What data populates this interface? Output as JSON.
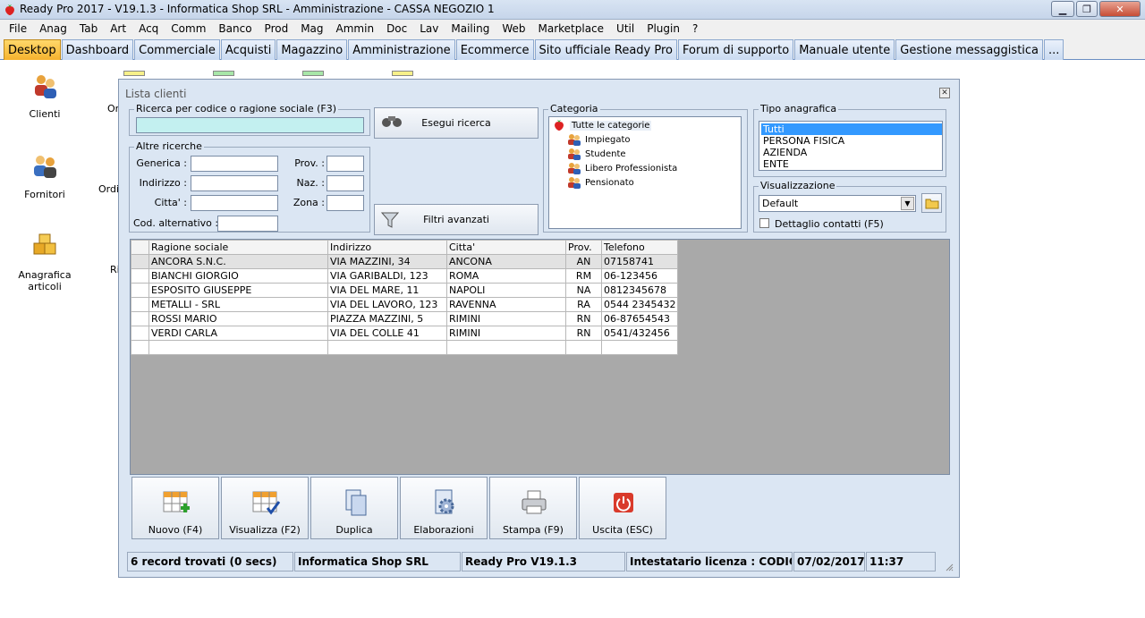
{
  "window": {
    "title": "Ready Pro 2017 - V19.1.3 - Informatica Shop SRL - Amministrazione - CASSA NEGOZIO 1"
  },
  "menu": [
    "File",
    "Anag",
    "Tab",
    "Art",
    "Acq",
    "Comm",
    "Banco",
    "Prod",
    "Mag",
    "Ammin",
    "Doc",
    "Lav",
    "Mailing",
    "Web",
    "Marketplace",
    "Util",
    "Plugin",
    "?"
  ],
  "tabs": [
    "Desktop",
    "Dashboard",
    "Commerciale",
    "Acquisti",
    "Magazzino",
    "Amministrazione",
    "Ecommerce",
    "Sito ufficiale Ready Pro",
    "Forum di supporto",
    "Manuale utente",
    "Gestione messaggistica",
    "..."
  ],
  "desktop": {
    "icons": [
      "Clienti",
      "Fornitori",
      "Anagrafica articoli"
    ],
    "partial_labels": [
      "Or",
      "Ordi",
      "Ri"
    ]
  },
  "dialog": {
    "title": "Lista clienti",
    "search": {
      "group_label": "Ricerca per codice o ragione sociale (F3)",
      "value": "",
      "button": "Esegui ricerca"
    },
    "other": {
      "group_label": "Altre ricerche",
      "generica": "Generica :",
      "indirizzo": "Indirizzo :",
      "citta": "Citta' :",
      "cod_alt": "Cod. alternativo :",
      "prov": "Prov. :",
      "naz": "Naz. :",
      "zona": "Zona :"
    },
    "filter_button": "Filtri avanzati",
    "categoria": {
      "group_label": "Categoria",
      "items": [
        "Tutte le categorie",
        "Impiegato",
        "Studente",
        "Libero Professionista",
        "Pensionato"
      ]
    },
    "tipo": {
      "group_label": "Tipo anagrafica",
      "options": [
        "Tutti",
        "PERSONA FISICA",
        "AZIENDA",
        "ENTE"
      ],
      "selected": "Tutti"
    },
    "visualizzazione": {
      "group_label": "Visualizzazione",
      "selected": "Default",
      "checkbox_label": "Dettaglio contatti (F5)"
    },
    "grid": {
      "columns": [
        "Ragione sociale",
        "Indirizzo",
        "Citta'",
        "Prov.",
        "Telefono"
      ],
      "rows": [
        [
          "ANCORA S.N.C.",
          "VIA MAZZINI, 34",
          "ANCONA",
          "AN",
          "07158741"
        ],
        [
          "BIANCHI GIORGIO",
          "VIA GARIBALDI, 123",
          "ROMA",
          "RM",
          "06-123456"
        ],
        [
          "ESPOSITO GIUSEPPE",
          "VIA DEL MARE, 11",
          "NAPOLI",
          "NA",
          "0812345678"
        ],
        [
          "METALLI - SRL",
          "VIA DEL LAVORO, 123",
          "RAVENNA",
          "RA",
          "0544 2345432"
        ],
        [
          "ROSSI MARIO",
          "PIAZZA MAZZINI, 5",
          "RIMINI",
          "RN",
          "06-87654543"
        ],
        [
          "VERDI CARLA",
          "VIA DEL COLLE 41",
          "RIMINI",
          "RN",
          "0541/432456"
        ]
      ]
    },
    "actions": [
      "Nuovo (F4)",
      "Visualizza (F2)",
      "Duplica",
      "Elaborazioni",
      "Stampa (F9)",
      "Uscita (ESC)"
    ],
    "status": [
      "6 record trovati (0 secs)",
      "Informatica Shop SRL",
      "Ready Pro V19.1.3",
      "Intestatario licenza : CODICE SR",
      "07/02/2017",
      "11:37"
    ]
  }
}
